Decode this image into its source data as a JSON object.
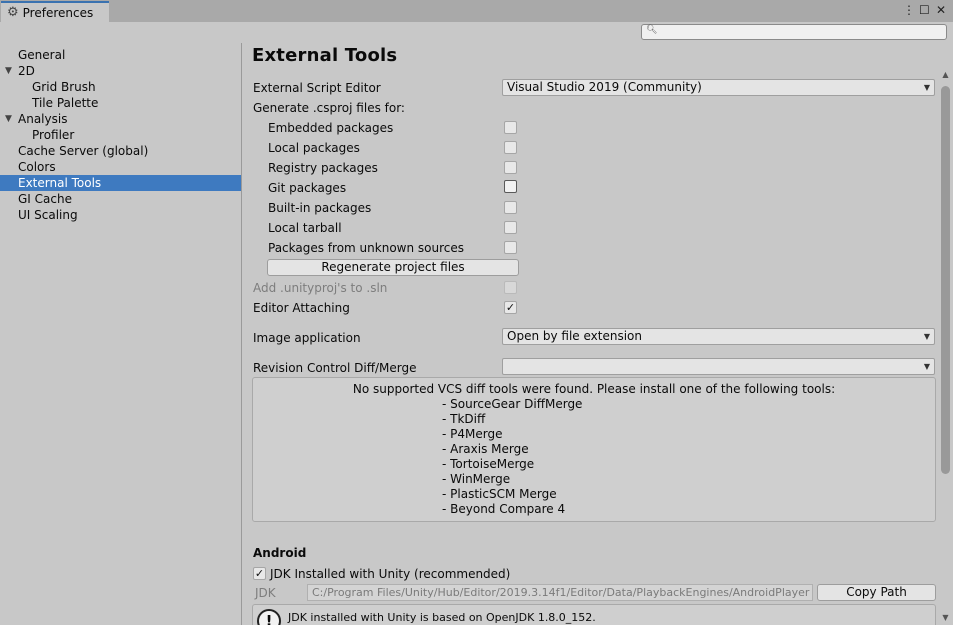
{
  "window": {
    "tab_title": "Preferences",
    "controls": {
      "menu": "⋮",
      "maximize": "☐",
      "close": "✕"
    }
  },
  "search": {
    "placeholder": ""
  },
  "sidebar": {
    "items": [
      {
        "label": "General",
        "level": 0,
        "expanded": null,
        "selected": false
      },
      {
        "label": "2D",
        "level": 0,
        "expanded": true,
        "selected": false
      },
      {
        "label": "Grid Brush",
        "level": 1,
        "expanded": null,
        "selected": false
      },
      {
        "label": "Tile Palette",
        "level": 1,
        "expanded": null,
        "selected": false
      },
      {
        "label": "Analysis",
        "level": 0,
        "expanded": true,
        "selected": false
      },
      {
        "label": "Profiler",
        "level": 1,
        "expanded": null,
        "selected": false
      },
      {
        "label": "Cache Server (global)",
        "level": 0,
        "expanded": null,
        "selected": false
      },
      {
        "label": "Colors",
        "level": 0,
        "expanded": null,
        "selected": false
      },
      {
        "label": "External Tools",
        "level": 0,
        "expanded": null,
        "selected": true
      },
      {
        "label": "GI Cache",
        "level": 0,
        "expanded": null,
        "selected": false
      },
      {
        "label": "UI Scaling",
        "level": 0,
        "expanded": null,
        "selected": false
      }
    ]
  },
  "main": {
    "title": "External Tools",
    "script_editor": {
      "label": "External Script Editor",
      "value": "Visual Studio 2019 (Community)"
    },
    "generate_label": "Generate .csproj files for:",
    "packages": [
      {
        "label": "Embedded packages",
        "checked": false
      },
      {
        "label": "Local packages",
        "checked": false
      },
      {
        "label": "Registry packages",
        "checked": false
      },
      {
        "label": "Git packages",
        "checked": false
      },
      {
        "label": "Built-in packages",
        "checked": false
      },
      {
        "label": "Local tarball",
        "checked": false
      },
      {
        "label": "Packages from unknown sources",
        "checked": false
      }
    ],
    "regenerate_button": "Regenerate project files",
    "add_unityproj": {
      "label": "Add .unityproj's to .sln",
      "checked": false,
      "disabled": true
    },
    "editor_attaching": {
      "label": "Editor Attaching",
      "checked": true,
      "checkmark": "✓"
    },
    "image_application": {
      "label": "Image application",
      "value": "Open by file extension"
    },
    "revision_control": {
      "label": "Revision Control Diff/Merge",
      "value": ""
    },
    "vcs_message": "No supported VCS diff tools were found. Please install one of the following tools:",
    "vcs_tools": [
      "- SourceGear DiffMerge",
      "- TkDiff",
      "- P4Merge",
      "- Araxis Merge",
      "- TortoiseMerge",
      "- WinMerge",
      "- PlasticSCM Merge",
      "- Beyond Compare 4"
    ],
    "android": {
      "heading": "Android",
      "jdk_installed": {
        "label": "JDK Installed with Unity (recommended)",
        "checked": true,
        "checkmark": "✓"
      },
      "jdk_label": "JDK",
      "jdk_path": "C:/Program Files/Unity/Hub/Editor/2019.3.14f1/Editor/Data/PlaybackEngines/AndroidPlayer",
      "copy_path_button": "Copy Path",
      "jdk_note": "JDK installed with Unity is based on OpenJDK 1.8.0_152."
    }
  },
  "colors": {
    "selection": "#3e7ac0",
    "tab_accent": "#3a72b0",
    "panel_bg": "#c8c8c8"
  }
}
